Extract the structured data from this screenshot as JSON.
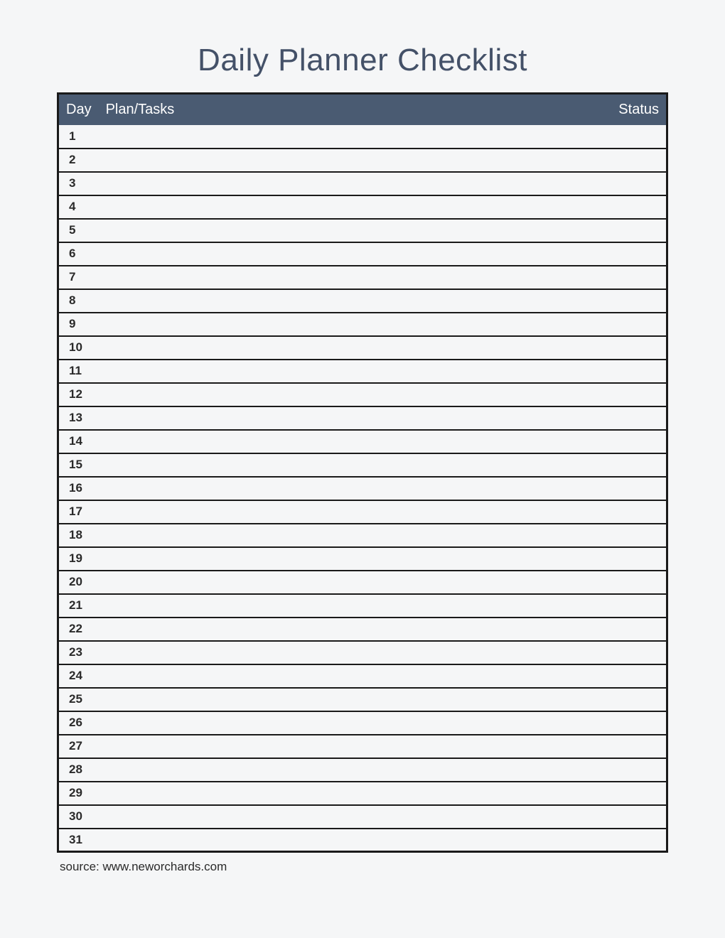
{
  "title": "Daily Planner Checklist",
  "columns": {
    "day": "Day",
    "plan": "Plan/Tasks",
    "status": "Status"
  },
  "rows": [
    {
      "day": "1",
      "plan": "",
      "status": ""
    },
    {
      "day": "2",
      "plan": "",
      "status": ""
    },
    {
      "day": "3",
      "plan": "",
      "status": ""
    },
    {
      "day": "4",
      "plan": "",
      "status": ""
    },
    {
      "day": "5",
      "plan": "",
      "status": ""
    },
    {
      "day": "6",
      "plan": "",
      "status": ""
    },
    {
      "day": "7",
      "plan": "",
      "status": ""
    },
    {
      "day": "8",
      "plan": "",
      "status": ""
    },
    {
      "day": "9",
      "plan": "",
      "status": ""
    },
    {
      "day": "10",
      "plan": "",
      "status": ""
    },
    {
      "day": "11",
      "plan": "",
      "status": ""
    },
    {
      "day": "12",
      "plan": "",
      "status": ""
    },
    {
      "day": "13",
      "plan": "",
      "status": ""
    },
    {
      "day": "14",
      "plan": "",
      "status": ""
    },
    {
      "day": "15",
      "plan": "",
      "status": ""
    },
    {
      "day": "16",
      "plan": "",
      "status": ""
    },
    {
      "day": "17",
      "plan": "",
      "status": ""
    },
    {
      "day": "18",
      "plan": "",
      "status": ""
    },
    {
      "day": "19",
      "plan": "",
      "status": ""
    },
    {
      "day": "20",
      "plan": "",
      "status": ""
    },
    {
      "day": "21",
      "plan": "",
      "status": ""
    },
    {
      "day": "22",
      "plan": "",
      "status": ""
    },
    {
      "day": "23",
      "plan": "",
      "status": ""
    },
    {
      "day": "24",
      "plan": "",
      "status": ""
    },
    {
      "day": "25",
      "plan": "",
      "status": ""
    },
    {
      "day": "26",
      "plan": "",
      "status": ""
    },
    {
      "day": "27",
      "plan": "",
      "status": ""
    },
    {
      "day": "28",
      "plan": "",
      "status": ""
    },
    {
      "day": "29",
      "plan": "",
      "status": ""
    },
    {
      "day": "30",
      "plan": "",
      "status": ""
    },
    {
      "day": "31",
      "plan": "",
      "status": ""
    }
  ],
  "source": "source: www.neworchards.com"
}
